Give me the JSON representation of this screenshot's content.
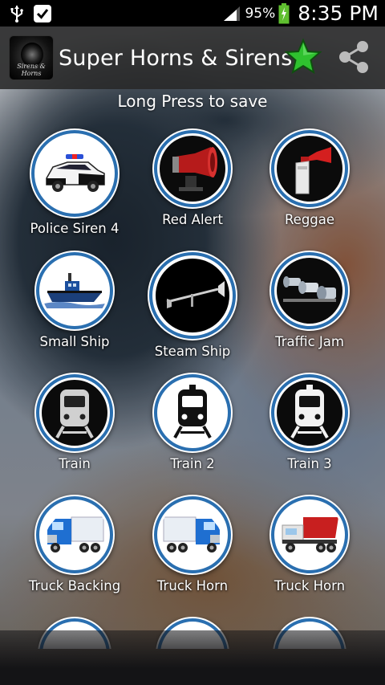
{
  "status_bar": {
    "battery": "95%",
    "time": "8:35 PM"
  },
  "action_bar": {
    "title": "Super Horns & Sirens",
    "icon_text": "Sirens & Horns"
  },
  "subtitle": "Long Press to save",
  "sounds": [
    {
      "label": "Police Siren 4",
      "icon": "police-car-icon"
    },
    {
      "label": "Red Alert",
      "icon": "alarm-horn-icon"
    },
    {
      "label": "Reggae",
      "icon": "air-horn-icon"
    },
    {
      "label": "Small Ship",
      "icon": "tugboat-icon"
    },
    {
      "label": "Steam Ship",
      "icon": "steam-horn-icon"
    },
    {
      "label": "Traffic Jam",
      "icon": "truck-horns-icon"
    },
    {
      "label": "Train",
      "icon": "train-icon"
    },
    {
      "label": "Train 2",
      "icon": "train-icon"
    },
    {
      "label": "Train 3",
      "icon": "train-icon"
    },
    {
      "label": "Truck Backing",
      "icon": "blue-truck-icon"
    },
    {
      "label": "Truck Horn",
      "icon": "blue-truck-icon"
    },
    {
      "label": "Truck Horn",
      "icon": "dump-truck-icon"
    }
  ],
  "colors": {
    "ring_blue": "#2a6fb0",
    "star_green": "#2fc12f"
  }
}
